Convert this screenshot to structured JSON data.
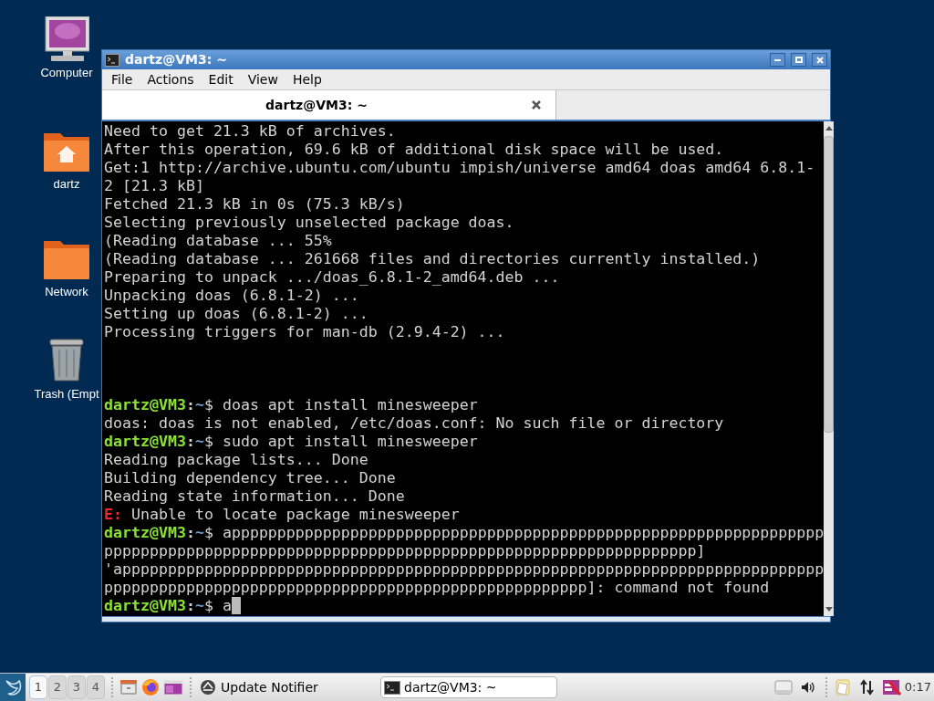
{
  "desktop_icons": [
    {
      "kind": "computer",
      "label": "Computer"
    },
    {
      "kind": "home",
      "label": "dartz"
    },
    {
      "kind": "folder",
      "label": "Network"
    },
    {
      "kind": "trash",
      "label": "Trash (Empt"
    }
  ],
  "window": {
    "title": "dartz@VM3: ~"
  },
  "menu": [
    "File",
    "Actions",
    "Edit",
    "View",
    "Help"
  ],
  "tabs": [
    {
      "label": "dartz@VM3: ~",
      "selected": true
    }
  ],
  "terminal": {
    "cursor": true,
    "lines": [
      {
        "kind": "text",
        "text": "Need to get 21.3 kB of archives."
      },
      {
        "kind": "text",
        "text": "After this operation, 69.6 kB of additional disk space will be used."
      },
      {
        "kind": "text",
        "text": "Get:1 http://archive.ubuntu.com/ubuntu impish/universe amd64 doas amd64 6.8.1-"
      },
      {
        "kind": "text",
        "text": "2 [21.3 kB]"
      },
      {
        "kind": "text",
        "text": "Fetched 21.3 kB in 0s (75.3 kB/s)"
      },
      {
        "kind": "text",
        "text": "Selecting previously unselected package doas."
      },
      {
        "kind": "text",
        "text": "(Reading database ... 55%"
      },
      {
        "kind": "text",
        "text": "(Reading database ... 261668 files and directories currently installed.)"
      },
      {
        "kind": "text",
        "text": "Preparing to unpack .../doas_6.8.1-2_amd64.deb ..."
      },
      {
        "kind": "text",
        "text": "Unpacking doas (6.8.1-2) ..."
      },
      {
        "kind": "text",
        "text": "Setting up doas (6.8.1-2) ..."
      },
      {
        "kind": "text",
        "text": "Processing triggers for man-db (2.9.4-2) ..."
      },
      {
        "kind": "blank"
      },
      {
        "kind": "blank"
      },
      {
        "kind": "blank"
      },
      {
        "kind": "prompt",
        "user": "dartz@VM3",
        "sep": ":",
        "path": "~",
        "symbol": "$",
        "command": "doas apt install minesweeper"
      },
      {
        "kind": "text",
        "text": "doas: doas is not enabled, /etc/doas.conf: No such file or directory"
      },
      {
        "kind": "prompt",
        "user": "dartz@VM3",
        "sep": ":",
        "path": "~",
        "symbol": "$",
        "command": "sudo apt install minesweeper"
      },
      {
        "kind": "text",
        "text": "Reading package lists... Done"
      },
      {
        "kind": "text",
        "text": "Building dependency tree... Done"
      },
      {
        "kind": "text",
        "text": "Reading state information... Done"
      },
      {
        "kind": "error",
        "label": "E:",
        "text": "Unable to locate package minesweeper"
      },
      {
        "kind": "prompt",
        "user": "dartz@VM3",
        "sep": ":",
        "path": "~",
        "symbol": "$",
        "command": "appppppppppppppppppppppppppppppppppppppppppppppppppppppppppppppppp"
      },
      {
        "kind": "text",
        "text": "ppppppppppppppppppppppppppppppppppppppppppppppppppppppppppppppppp]"
      },
      {
        "kind": "text",
        "text": "'appppppppppppppppppppppppppppppppppppppppppppppppppppppppppppppppppppppppppppp"
      },
      {
        "kind": "text",
        "text": "ppppppppppppppppppppppppppppppppppppppppppppppppppppp]: command not found"
      },
      {
        "kind": "prompt",
        "user": "dartz@VM3",
        "sep": ":",
        "path": "~",
        "symbol": "$",
        "command": "a"
      }
    ]
  },
  "taskbar": {
    "desktops": [
      {
        "label": "1",
        "selected": true
      },
      {
        "label": "2",
        "selected": false
      },
      {
        "label": "3",
        "selected": false
      },
      {
        "label": "4",
        "selected": false
      }
    ],
    "launchers": [
      {
        "label": "Update Notifier"
      }
    ],
    "tasks": [
      {
        "label": "dartz@VM3: ~",
        "selected": false
      }
    ],
    "clock": "0:17"
  }
}
